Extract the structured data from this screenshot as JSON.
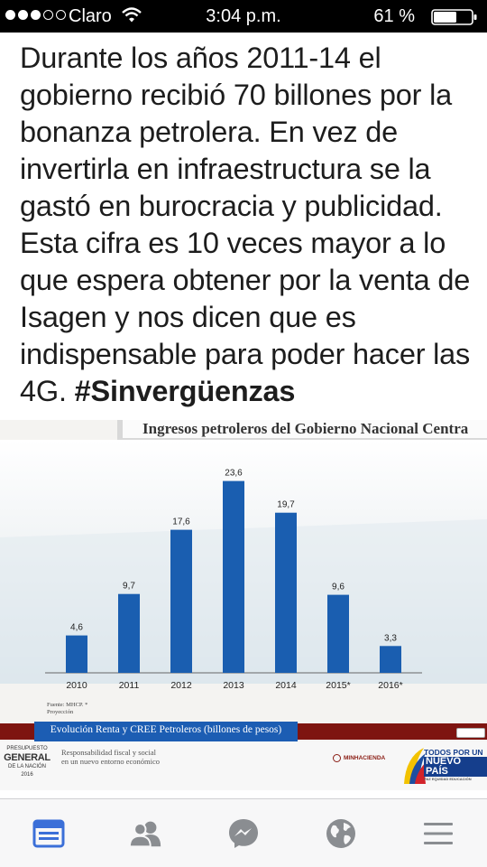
{
  "status_bar": {
    "signal_filled": 3,
    "signal_total": 5,
    "carrier": "Claro",
    "time": "3:04 p.m.",
    "battery": "61 %",
    "battery_level": 0.61
  },
  "post": {
    "text": "Durante los años 2011-14 el gobierno recibió 70 billones por la bonanza petrolera. En vez de invertirla en infraestructura se la gastó en burocracia y publicidad. Esta cifra es 10 veces mayor a lo que espera obtener por la venta de Isagen y nos dicen que es indispensable para poder hacer las 4G.",
    "hashtag": "#Sinvergüenzas"
  },
  "slide": {
    "title": "Ingresos petroleros del Gobierno Nacional Centra",
    "source": "Fuente: MHCP. *",
    "source_note": "Proyección",
    "caption": "Evolución Renta y CREE Petroleros (billones de pesos)",
    "footer_logo": [
      "PRESUPUESTO",
      "GENERAL",
      "DE LA NACIÓN",
      "2016"
    ],
    "footer_text": [
      "Responsabilidad fiscal y social",
      "en un nuevo entorno económico"
    ],
    "ministry": "MINHACIENDA",
    "campaign": [
      "TODOS POR UN",
      "NUEVO PAÍS",
      "PAZ  EQUIDAD  EDUCACIÓN"
    ]
  },
  "chart_data": {
    "type": "bar",
    "title": "Ingresos petroleros del Gobierno Nacional Centra",
    "categories": [
      "2010",
      "2011",
      "2012",
      "2013",
      "2014",
      "2015*",
      "2016*"
    ],
    "values": [
      4.6,
      9.7,
      17.6,
      23.6,
      19.7,
      9.6,
      3.3
    ],
    "data_labels": [
      "4,6",
      "9,7",
      "17,6",
      "23,6",
      "19,7",
      "9,6",
      "3,3"
    ],
    "ylim": [
      0,
      25
    ],
    "grid": false,
    "bar_color": "#1a5eb0"
  },
  "tabs": [
    {
      "name": "news-feed",
      "icon": "newsfeed-icon",
      "active": true
    },
    {
      "name": "friends",
      "icon": "friends-icon",
      "active": false
    },
    {
      "name": "messenger",
      "icon": "messenger-icon",
      "active": false
    },
    {
      "name": "notifications",
      "icon": "globe-icon",
      "active": false
    },
    {
      "name": "more",
      "icon": "menu-icon",
      "active": false
    }
  ],
  "colors": {
    "active_tab": "#3b6fd8",
    "inactive_tab": "#8a8d91",
    "slide_band": "#7e1410",
    "caption_box": "#1c5db3"
  }
}
